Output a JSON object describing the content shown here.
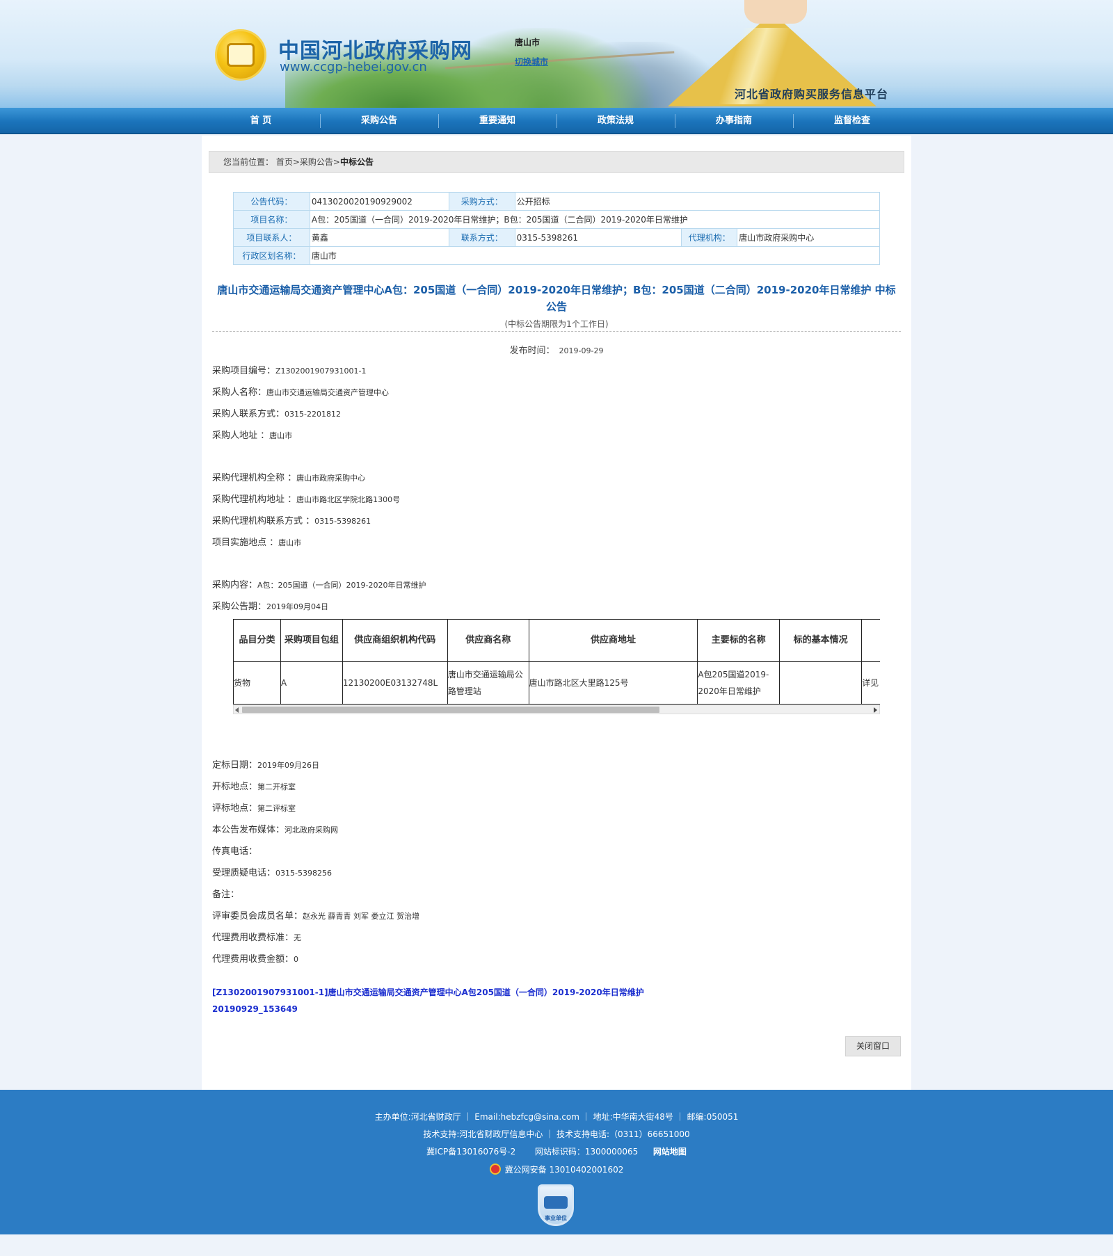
{
  "header": {
    "site_title": "中国河北政府采购网",
    "site_url": "www.ccgp-hebei.gov.cn",
    "city": "唐山市",
    "switch_city": "切换城市",
    "platform": "河北省政府购买服务信息平台"
  },
  "nav": [
    "首 页",
    "采购公告",
    "重要通知",
    "政策法规",
    "办事指南",
    "监督检查"
  ],
  "breadcrumb": {
    "prefix": "您当前位置：",
    "path": "首页>采购公告>",
    "current": "中标公告"
  },
  "meta": {
    "code_label": "公告代码：",
    "code": "0413020020190929002",
    "method_label": "采购方式：",
    "method": "公开招标",
    "name_label": "项目名称：",
    "name": "A包：205国道（一合同）2019-2020年日常维护；B包：205国道（二合同）2019-2020年日常维护",
    "contact_label": "项目联系人：",
    "contact": "黄鑫",
    "phone_label": "联系方式：",
    "phone": "0315-5398261",
    "agency_label": "代理机构：",
    "agency": "唐山市政府采购中心",
    "region_label": "行政区划名称：",
    "region": "唐山市"
  },
  "notice": {
    "title": "唐山市交通运输局交通资产管理中心A包：205国道（一合同）2019-2020年日常维护；B包：205国道（二合同）2019-2020年日常维护 中标公告",
    "period": "(中标公告期限为1个工作日)",
    "pub_label": "发布时间：",
    "pub_date": "2019-09-29"
  },
  "fields": [
    {
      "label": "采购项目编号：",
      "value": "Z1302001907931001-1"
    },
    {
      "label": "采购人名称：",
      "value": "唐山市交通运输局交通资产管理中心"
    },
    {
      "label": "采购人联系方式：",
      "value": "0315-2201812"
    },
    {
      "label": "采购人地址 ：",
      "value": "唐山市"
    },
    {
      "label": "",
      "value": ""
    },
    {
      "label": "采购代理机构全称 ：",
      "value": "唐山市政府采购中心"
    },
    {
      "label": "采购代理机构地址 ：",
      "value": "唐山市路北区学院北路1300号"
    },
    {
      "label": "采购代理机构联系方式 ：",
      "value": "0315-5398261"
    },
    {
      "label": "项目实施地点 ：",
      "value": "唐山市"
    },
    {
      "label": "",
      "value": ""
    },
    {
      "label": "采购内容：",
      "value": "A包：205国道（一合同）2019-2020年日常维护"
    },
    {
      "label": "采购公告期：",
      "value": "2019年09月04日"
    }
  ],
  "result_table": {
    "headers": [
      "品目分类",
      "采购项目包组",
      "供应商组织机构代码",
      "供应商名称",
      "供应商地址",
      "主要标的名称",
      "标的基本情况",
      ""
    ],
    "rows": [
      [
        "货物",
        "A",
        "12130200E03132748L",
        "唐山市交通运输局公路管理站",
        "唐山市路北区大里路125号",
        "A包205国道2019-2020年日常维护",
        "",
        "详见"
      ]
    ]
  },
  "fields2": [
    {
      "label": "定标日期：",
      "value": "2019年09月26日"
    },
    {
      "label": "开标地点：",
      "value": "第二开标室"
    },
    {
      "label": "评标地点：",
      "value": "第二评标室"
    },
    {
      "label": "本公告发布媒体：",
      "value": "河北政府采购网"
    },
    {
      "label": "传真电话：",
      "value": ""
    },
    {
      "label": "受理质疑电话：",
      "value": "0315-5398256"
    },
    {
      "label": "备注：",
      "value": ""
    },
    {
      "label": "评审委员会成员名单：",
      "value": "赵永光 薛青青 刘军 娄立江 贺治增"
    },
    {
      "label": "代理费用收费标准：",
      "value": "无"
    },
    {
      "label": "代理费用收费金额：",
      "value": "0"
    }
  ],
  "attachment": {
    "line1": "[Z1302001907931001-1]唐山市交通运输局交通资产管理中心A包205国道（一合同）2019-2020年日常维护",
    "line2": "20190929_153649"
  },
  "close_button": "关闭窗口",
  "footer": {
    "line1": "主办单位:河北省财政厅 ｜ Email:hebzfcg@sina.com ｜ 地址:中华南大街48号 ｜ 邮编:050051",
    "line2": "技术支持:河北省财政厅信息中心 ｜ 技术支持电话:（0311）66651000",
    "icp": "冀ICP备13016076号-2",
    "site_id": "网站标识码：1300000065",
    "sitemap": "网站地图",
    "police": "冀公网安备 13010402001602",
    "badge_text": "事业单位"
  }
}
